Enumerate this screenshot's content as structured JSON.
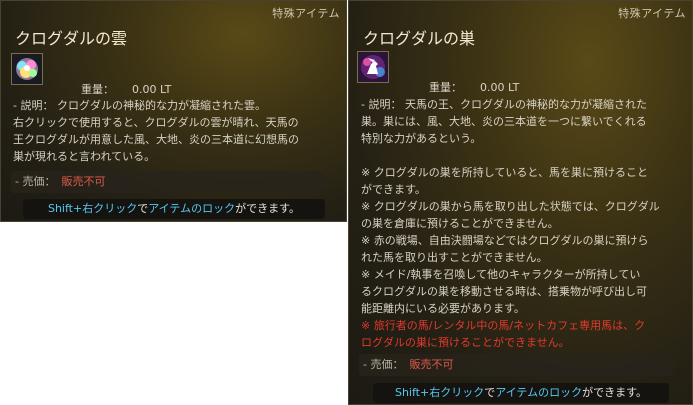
{
  "tooltip_cloud": {
    "category": "特殊アイテム",
    "title": "クログダルの雲",
    "icon": "rainbow-cloud-icon",
    "weight_label": "重量：",
    "weight_value": "0.00 LT",
    "desc_lines": [
      "- 説明： クログダルの神秘的な力が凝縮された雲。",
      "右クリックで使用すると、クログダルの雲が晴れ、天馬の",
      "王クログダルが用意した風、大地、炎の三本道に幻想馬の",
      "巣が現れると言われている。"
    ],
    "price_label": "- 売価：",
    "price_value": "販売不可",
    "footer_key1": "Shift+右クリック",
    "footer_mid": "で",
    "footer_key2": "アイテムのロック",
    "footer_end": "ができます。"
  },
  "tooltip_nest": {
    "category": "特殊アイテム",
    "title": "クログダルの巣",
    "icon": "pegasus-nest-icon",
    "weight_label": "重量：",
    "weight_value": "0.00 LT",
    "desc_lines": [
      "- 説明： 天馬の王、クログダルの神秘的な力が凝縮された",
      "巣。巣には、風、大地、炎の三本道を一つに繋いでくれる",
      "特別な力があるという。"
    ],
    "note_lines": [
      "※ クログダルの巣を所持していると、馬を巣に預けること",
      "ができます。",
      "※ クログダルの巣から馬を取り出した状態では、クログダル",
      "の巣を倉庫に預けることができません。",
      "※ 赤の戦場、自由決闘場などではクログダルの巣に預けら",
      "れた馬を取り出すことができません。",
      "※ メイド/執事を召喚して他のキャラクターが所持してい",
      "るクログダルの巣を移動させる時は、搭乗物が呼び出し可",
      "能距離内にいる必要があります。"
    ],
    "warn_lines": [
      "※ 旅行者の馬/レンタル中の馬/ネットカフェ専用馬は、ク",
      "ログダルの巣に預けることができません。"
    ],
    "price_label": "- 売価：",
    "price_value": "販売不可",
    "footer_key1": "Shift+右クリック",
    "footer_mid": "で",
    "footer_key2": "アイテムのロック",
    "footer_end": "ができます。"
  },
  "colors": {
    "accent_blue": "#58c8f0",
    "warning_red": "#e23a2e",
    "price_red": "#e05a4a"
  }
}
